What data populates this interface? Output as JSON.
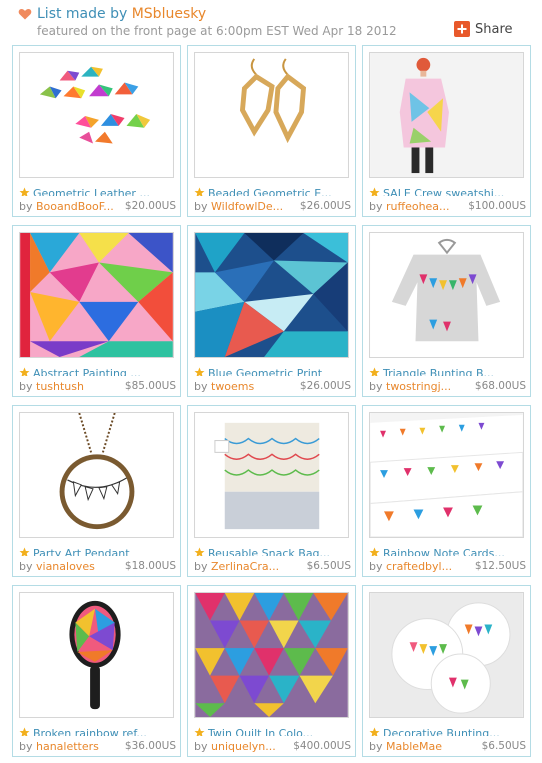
{
  "header": {
    "title_prefix": "List made by ",
    "curator": "MSbluesky",
    "featured": "featured on the front page at 6:00pm EST Wed Apr 18 2012",
    "share_label": "Share"
  },
  "items": [
    {
      "name": "Geometric Leather ...",
      "by": "by",
      "shop": "BooandBooF...",
      "price": "$20.00US"
    },
    {
      "name": "Beaded Geometric E...",
      "by": "by",
      "shop": "WildfowlDe...",
      "price": "$26.00US"
    },
    {
      "name": "SALE Crew sweatshi...",
      "by": "by",
      "shop": "ruffeohea...",
      "price": "$100.00US"
    },
    {
      "name": "Abstract Painting ...",
      "by": "by",
      "shop": "tushtush",
      "price": "$85.00US"
    },
    {
      "name": "Blue Geometric Print",
      "by": "by",
      "shop": "twoems",
      "price": "$26.00US"
    },
    {
      "name": "Triangle Bunting B...",
      "by": "by",
      "shop": "twostringj...",
      "price": "$68.00US"
    },
    {
      "name": "Party Art Pendant",
      "by": "by",
      "shop": "vianaloves",
      "price": "$18.00US"
    },
    {
      "name": "Reusable Snack Bag...",
      "by": "by",
      "shop": "ZerlinaCra...",
      "price": "$6.50US"
    },
    {
      "name": "Rainbow Note Cards...",
      "by": "by",
      "shop": "craftedbyl...",
      "price": "$12.50US"
    },
    {
      "name": "Broken rainbow ref...",
      "by": "by",
      "shop": "hanaletters",
      "price": "$36.00US"
    },
    {
      "name": "Twin Quilt In Colo...",
      "by": "by",
      "shop": "uniquelyn...",
      "price": "$400.00US"
    },
    {
      "name": "Decorative Bunting...",
      "by": "by",
      "shop": "MableMae",
      "price": "$6.50US"
    }
  ],
  "colors": {
    "link_blue": "#3f8fb6",
    "shop_orange": "#e8872c",
    "card_border": "#b4dce5",
    "share_red": "#e8592b",
    "star_gold": "#f2b01e"
  }
}
